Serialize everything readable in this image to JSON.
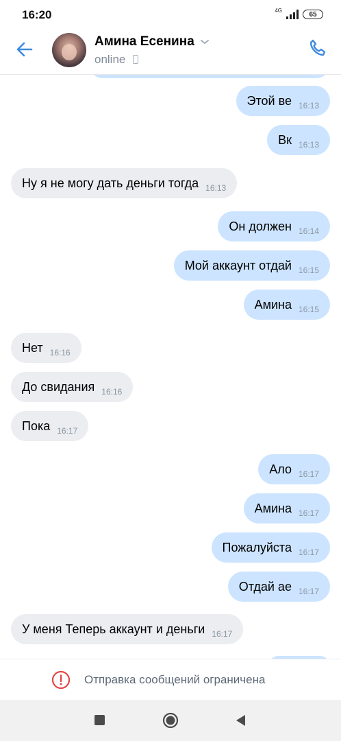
{
  "status_bar": {
    "time": "16:20",
    "network": "4G",
    "battery": "65"
  },
  "header": {
    "contact_name": "Амина Есенина",
    "status": "online",
    "icons": [
      "back-arrow-icon",
      "chevron-down-icon",
      "mobile-icon",
      "phone-icon"
    ],
    "accent_color": "#3f8ae0"
  },
  "messages": [
    {
      "direction": "out",
      "text": "Этой ве",
      "time": "16:13"
    },
    {
      "direction": "out",
      "text": "Вк",
      "time": "16:13"
    },
    {
      "direction": "in",
      "text": "Ну я не могу дать деньги тогда",
      "time": "16:13"
    },
    {
      "direction": "out",
      "text": "Он должен",
      "time": "16:14"
    },
    {
      "direction": "out",
      "text": "Мой аккаунт отдай",
      "time": "16:15"
    },
    {
      "direction": "out",
      "text": "Амина",
      "time": "16:15"
    },
    {
      "direction": "in",
      "text": "Нет",
      "time": "16:16"
    },
    {
      "direction": "in",
      "text": "До свидания",
      "time": "16:16"
    },
    {
      "direction": "in",
      "text": "Пока",
      "time": "16:17"
    },
    {
      "direction": "out",
      "text": "Ало",
      "time": "16:17"
    },
    {
      "direction": "out",
      "text": "Амина",
      "time": "16:17"
    },
    {
      "direction": "out",
      "text": "Пожалуйста",
      "time": "16:17"
    },
    {
      "direction": "out",
      "text": "Отдай ае",
      "time": "16:17"
    },
    {
      "direction": "in",
      "text": "У меня Теперь аккаунт и деньги",
      "time": "16:17"
    }
  ],
  "colors": {
    "outgoing_bubble": "#cce4ff",
    "incoming_bubble": "#ebedf0",
    "alert": "#e64646"
  },
  "restriction": {
    "text": "Отправка сообщений ограничена",
    "icon": "alert-circle-icon"
  },
  "nav": {
    "icons": [
      "recent-apps-icon",
      "home-icon",
      "back-icon"
    ]
  }
}
